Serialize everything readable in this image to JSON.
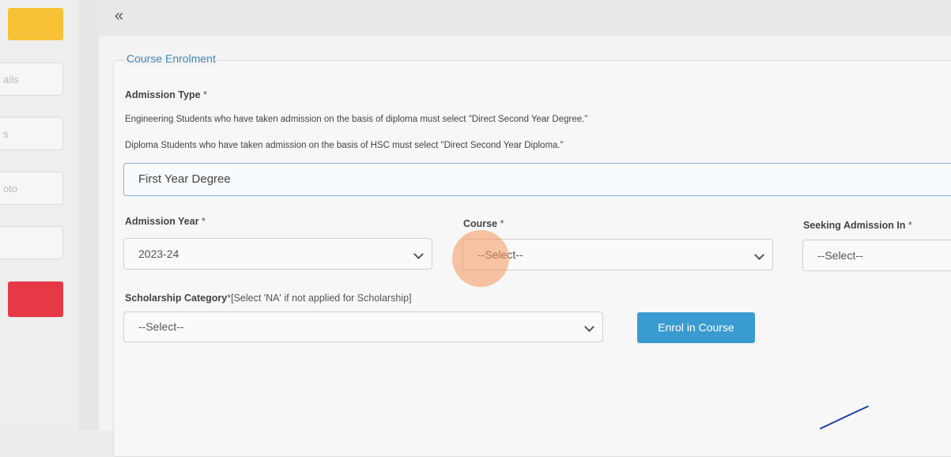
{
  "sidebar": {
    "items": [
      {
        "label": "ails"
      },
      {
        "label": "s"
      },
      {
        "label": "oto"
      },
      {
        "label": ""
      }
    ]
  },
  "topbar": {
    "collapse_icon": "«"
  },
  "form": {
    "legend": "Course Enrolment",
    "admission_type": {
      "label": "Admission Type",
      "required": "*",
      "help_1": "Engineering Students who have taken admission on the basis of diploma must select \"Direct Second Year Degree.\"",
      "help_2": "Diploma Students who have taken admission on the basis of HSC must select \"Direct Second Year Diploma.\"",
      "value": "First Year Degree"
    },
    "admission_year": {
      "label": "Admission Year",
      "required": "*",
      "value": "2023-24"
    },
    "course": {
      "label": "Course",
      "required": "*",
      "value": "--Select--"
    },
    "seeking_admission": {
      "label": "Seeking Admission In",
      "required": "*",
      "value": "--Select--"
    },
    "scholarship": {
      "label": "Scholarship Category",
      "required": "*",
      "note": "[Select 'NA' if not applied for Scholarship]",
      "value": "--Select--"
    },
    "enrol_button": "Enrol in Course"
  },
  "colors": {
    "accent": "#3a9bd0",
    "legend": "#3f86b8",
    "sidebar_yellow": "#f7c137",
    "sidebar_red": "#e63945"
  }
}
